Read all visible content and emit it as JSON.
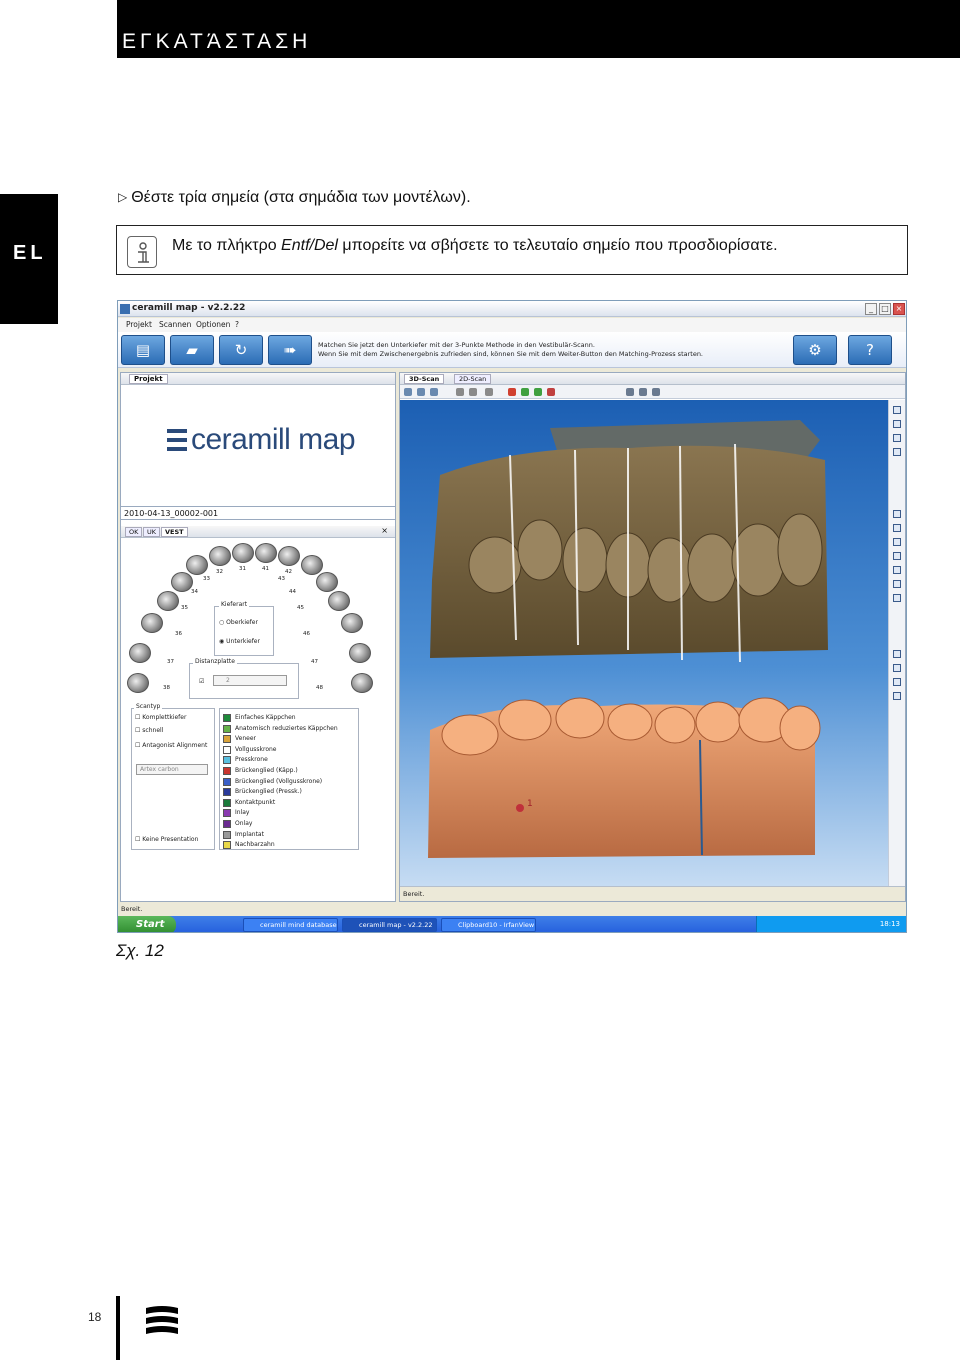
{
  "header": {
    "title": "ΕΓΚΑΤΆΣΤΑΣΗ"
  },
  "lang_tab": {
    "label": "EL"
  },
  "step": {
    "marker": "▷",
    "text": "Θέστε τρία σημεία (στα σημάδια των μοντέλων)."
  },
  "note": {
    "text_before": "Με το πλήκτρο ",
    "key": "Entf/Del",
    "text_after": " μπορείτε να σβήσετε το τελευταίο σημείο που προσδιορίσατε."
  },
  "screenshot": {
    "window_title": "ceramill map - v2.2.22",
    "menu": [
      "Projekt",
      "Scannen",
      "Optionen",
      "?"
    ],
    "instructions": [
      "Matchen Sie jetzt den Unterkiefer mit der 3-Punkte Methode in den Vestibulär-Scann.",
      "Wenn Sie mit dem Zwischenergebnis zufrieden sind, können Sie mit dem Weiter-Button den Matching-Prozess starten."
    ],
    "left_tab": "Projekt",
    "logo_text": "ceramill map",
    "case_id": "2010-04-13_00002-001",
    "jaw_tabs": [
      "OK",
      "UK",
      "VEST"
    ],
    "tooth_numbers_upper": [
      "32",
      "31",
      "41",
      "42"
    ],
    "tooth_numbers_left": [
      "33",
      "34",
      "35",
      "36",
      "37",
      "38"
    ],
    "tooth_numbers_right": [
      "43",
      "44",
      "45",
      "46",
      "47",
      "48"
    ],
    "kieferart": {
      "label": "Kieferart",
      "options": [
        "Oberkiefer",
        "Unterkiefer"
      ]
    },
    "distanzplatte": {
      "label": "Distanzplatte",
      "value": "2"
    },
    "scantyp": {
      "label": "Scantyp",
      "options": [
        "Komplettkiefer",
        "schnell",
        "Antagonist Alignment"
      ],
      "material": "Artex carbon",
      "presentation": "Keine Presentation"
    },
    "restorations": [
      {
        "label": "Einfaches Käppchen",
        "color": "#1e8a3a"
      },
      {
        "label": "Anatomisch reduziertes Käppchen",
        "color": "#66b34a"
      },
      {
        "label": "Veneer",
        "color": "#d9a43a"
      },
      {
        "label": "Vollgusskrone",
        "color": "#ffffff"
      },
      {
        "label": "Presskrone",
        "color": "#59c0e0"
      },
      {
        "label": "Brückenglied (Käpp.)",
        "color": "#c8352f"
      },
      {
        "label": "Brückenglied (Vollgusskrone)",
        "color": "#3a5fc8"
      },
      {
        "label": "Brückenglied (Pressk.)",
        "color": "#2a3a9a"
      },
      {
        "label": "Kontaktpunkt",
        "color": "#1a7a3a"
      },
      {
        "label": "Inlay",
        "color": "#8a3ab0"
      },
      {
        "label": "Onlay",
        "color": "#6a2a90"
      },
      {
        "label": "Implantat",
        "color": "#9a9a9a"
      },
      {
        "label": "Nachbarzahn",
        "color": "#e8d84a"
      }
    ],
    "view_tabs": [
      "3D-Scan",
      "2D-Scan"
    ],
    "point_marker": "1",
    "status_right": "Bereit.",
    "status_bottom": "Bereit.",
    "taskbar": {
      "start": "Start",
      "tasks": [
        "ceramill mind database",
        "ceramill map - v2.2.22",
        "Clipboard10 - IrfanView"
      ],
      "clock": "18:13"
    },
    "colors": {
      "viewport_top": "#1c5fb3",
      "upper_jaw": "#7a6540",
      "lower_jaw": "#d98a5e"
    }
  },
  "figure_caption": "Σχ. 12",
  "page_number": "18"
}
